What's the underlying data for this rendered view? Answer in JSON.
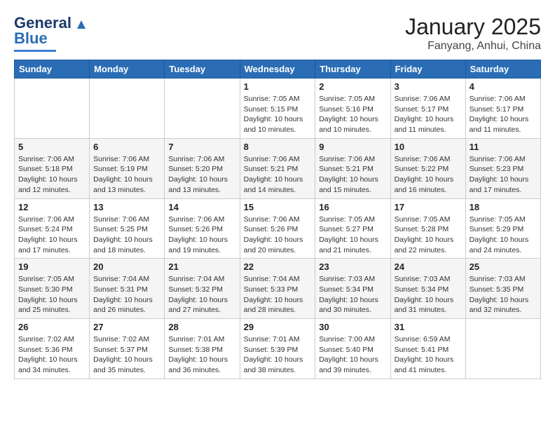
{
  "header": {
    "logo_general": "General",
    "logo_blue": "Blue",
    "title": "January 2025",
    "subtitle": "Fanyang, Anhui, China"
  },
  "weekdays": [
    "Sunday",
    "Monday",
    "Tuesday",
    "Wednesday",
    "Thursday",
    "Friday",
    "Saturday"
  ],
  "weeks": [
    [
      {
        "day": "",
        "sunrise": "",
        "sunset": "",
        "daylight": ""
      },
      {
        "day": "",
        "sunrise": "",
        "sunset": "",
        "daylight": ""
      },
      {
        "day": "",
        "sunrise": "",
        "sunset": "",
        "daylight": ""
      },
      {
        "day": "1",
        "sunrise": "Sunrise: 7:05 AM",
        "sunset": "Sunset: 5:15 PM",
        "daylight": "Daylight: 10 hours and 10 minutes."
      },
      {
        "day": "2",
        "sunrise": "Sunrise: 7:05 AM",
        "sunset": "Sunset: 5:16 PM",
        "daylight": "Daylight: 10 hours and 10 minutes."
      },
      {
        "day": "3",
        "sunrise": "Sunrise: 7:06 AM",
        "sunset": "Sunset: 5:17 PM",
        "daylight": "Daylight: 10 hours and 11 minutes."
      },
      {
        "day": "4",
        "sunrise": "Sunrise: 7:06 AM",
        "sunset": "Sunset: 5:17 PM",
        "daylight": "Daylight: 10 hours and 11 minutes."
      }
    ],
    [
      {
        "day": "5",
        "sunrise": "Sunrise: 7:06 AM",
        "sunset": "Sunset: 5:18 PM",
        "daylight": "Daylight: 10 hours and 12 minutes."
      },
      {
        "day": "6",
        "sunrise": "Sunrise: 7:06 AM",
        "sunset": "Sunset: 5:19 PM",
        "daylight": "Daylight: 10 hours and 13 minutes."
      },
      {
        "day": "7",
        "sunrise": "Sunrise: 7:06 AM",
        "sunset": "Sunset: 5:20 PM",
        "daylight": "Daylight: 10 hours and 13 minutes."
      },
      {
        "day": "8",
        "sunrise": "Sunrise: 7:06 AM",
        "sunset": "Sunset: 5:21 PM",
        "daylight": "Daylight: 10 hours and 14 minutes."
      },
      {
        "day": "9",
        "sunrise": "Sunrise: 7:06 AM",
        "sunset": "Sunset: 5:21 PM",
        "daylight": "Daylight: 10 hours and 15 minutes."
      },
      {
        "day": "10",
        "sunrise": "Sunrise: 7:06 AM",
        "sunset": "Sunset: 5:22 PM",
        "daylight": "Daylight: 10 hours and 16 minutes."
      },
      {
        "day": "11",
        "sunrise": "Sunrise: 7:06 AM",
        "sunset": "Sunset: 5:23 PM",
        "daylight": "Daylight: 10 hours and 17 minutes."
      }
    ],
    [
      {
        "day": "12",
        "sunrise": "Sunrise: 7:06 AM",
        "sunset": "Sunset: 5:24 PM",
        "daylight": "Daylight: 10 hours and 17 minutes."
      },
      {
        "day": "13",
        "sunrise": "Sunrise: 7:06 AM",
        "sunset": "Sunset: 5:25 PM",
        "daylight": "Daylight: 10 hours and 18 minutes."
      },
      {
        "day": "14",
        "sunrise": "Sunrise: 7:06 AM",
        "sunset": "Sunset: 5:26 PM",
        "daylight": "Daylight: 10 hours and 19 minutes."
      },
      {
        "day": "15",
        "sunrise": "Sunrise: 7:06 AM",
        "sunset": "Sunset: 5:26 PM",
        "daylight": "Daylight: 10 hours and 20 minutes."
      },
      {
        "day": "16",
        "sunrise": "Sunrise: 7:05 AM",
        "sunset": "Sunset: 5:27 PM",
        "daylight": "Daylight: 10 hours and 21 minutes."
      },
      {
        "day": "17",
        "sunrise": "Sunrise: 7:05 AM",
        "sunset": "Sunset: 5:28 PM",
        "daylight": "Daylight: 10 hours and 22 minutes."
      },
      {
        "day": "18",
        "sunrise": "Sunrise: 7:05 AM",
        "sunset": "Sunset: 5:29 PM",
        "daylight": "Daylight: 10 hours and 24 minutes."
      }
    ],
    [
      {
        "day": "19",
        "sunrise": "Sunrise: 7:05 AM",
        "sunset": "Sunset: 5:30 PM",
        "daylight": "Daylight: 10 hours and 25 minutes."
      },
      {
        "day": "20",
        "sunrise": "Sunrise: 7:04 AM",
        "sunset": "Sunset: 5:31 PM",
        "daylight": "Daylight: 10 hours and 26 minutes."
      },
      {
        "day": "21",
        "sunrise": "Sunrise: 7:04 AM",
        "sunset": "Sunset: 5:32 PM",
        "daylight": "Daylight: 10 hours and 27 minutes."
      },
      {
        "day": "22",
        "sunrise": "Sunrise: 7:04 AM",
        "sunset": "Sunset: 5:33 PM",
        "daylight": "Daylight: 10 hours and 28 minutes."
      },
      {
        "day": "23",
        "sunrise": "Sunrise: 7:03 AM",
        "sunset": "Sunset: 5:34 PM",
        "daylight": "Daylight: 10 hours and 30 minutes."
      },
      {
        "day": "24",
        "sunrise": "Sunrise: 7:03 AM",
        "sunset": "Sunset: 5:34 PM",
        "daylight": "Daylight: 10 hours and 31 minutes."
      },
      {
        "day": "25",
        "sunrise": "Sunrise: 7:03 AM",
        "sunset": "Sunset: 5:35 PM",
        "daylight": "Daylight: 10 hours and 32 minutes."
      }
    ],
    [
      {
        "day": "26",
        "sunrise": "Sunrise: 7:02 AM",
        "sunset": "Sunset: 5:36 PM",
        "daylight": "Daylight: 10 hours and 34 minutes."
      },
      {
        "day": "27",
        "sunrise": "Sunrise: 7:02 AM",
        "sunset": "Sunset: 5:37 PM",
        "daylight": "Daylight: 10 hours and 35 minutes."
      },
      {
        "day": "28",
        "sunrise": "Sunrise: 7:01 AM",
        "sunset": "Sunset: 5:38 PM",
        "daylight": "Daylight: 10 hours and 36 minutes."
      },
      {
        "day": "29",
        "sunrise": "Sunrise: 7:01 AM",
        "sunset": "Sunset: 5:39 PM",
        "daylight": "Daylight: 10 hours and 38 minutes."
      },
      {
        "day": "30",
        "sunrise": "Sunrise: 7:00 AM",
        "sunset": "Sunset: 5:40 PM",
        "daylight": "Daylight: 10 hours and 39 minutes."
      },
      {
        "day": "31",
        "sunrise": "Sunrise: 6:59 AM",
        "sunset": "Sunset: 5:41 PM",
        "daylight": "Daylight: 10 hours and 41 minutes."
      },
      {
        "day": "",
        "sunrise": "",
        "sunset": "",
        "daylight": ""
      }
    ]
  ]
}
